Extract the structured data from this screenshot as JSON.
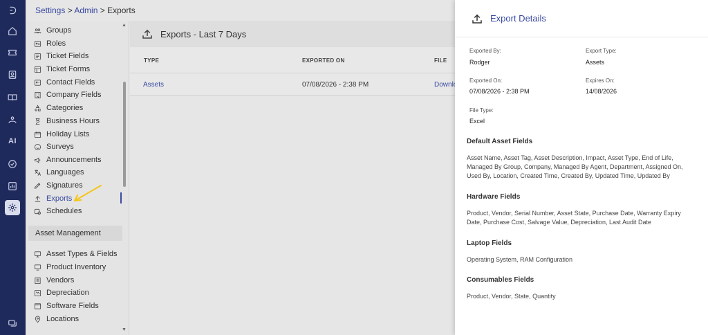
{
  "breadcrumb": {
    "settings": "Settings",
    "sep1": " > ",
    "admin": "Admin",
    "sep2": " > ",
    "current": "Exports"
  },
  "rail": {
    "ai_label": "AI"
  },
  "sidebar": {
    "items": [
      {
        "label": "Groups",
        "icon": "groups-icon"
      },
      {
        "label": "Roles",
        "icon": "roles-icon"
      },
      {
        "label": "Ticket Fields",
        "icon": "ticket-fields-icon"
      },
      {
        "label": "Ticket Forms",
        "icon": "ticket-forms-icon"
      },
      {
        "label": "Contact Fields",
        "icon": "contact-fields-icon"
      },
      {
        "label": "Company Fields",
        "icon": "company-fields-icon"
      },
      {
        "label": "Categories",
        "icon": "categories-icon"
      },
      {
        "label": "Business Hours",
        "icon": "hourglass-icon"
      },
      {
        "label": "Holiday Lists",
        "icon": "calendar-icon"
      },
      {
        "label": "Surveys",
        "icon": "smiley-icon"
      },
      {
        "label": "Announcements",
        "icon": "megaphone-icon"
      },
      {
        "label": "Languages",
        "icon": "translate-icon"
      },
      {
        "label": "Signatures",
        "icon": "signature-icon"
      },
      {
        "label": "Exports",
        "icon": "upload-icon"
      },
      {
        "label": "Schedules",
        "icon": "schedule-icon"
      }
    ],
    "section_header": "Asset Management",
    "asset_items": [
      {
        "label": "Asset Types & Fields",
        "icon": "asset-types-icon"
      },
      {
        "label": "Product Inventory",
        "icon": "inventory-icon"
      },
      {
        "label": "Vendors",
        "icon": "vendors-icon"
      },
      {
        "label": "Depreciation",
        "icon": "depreciation-icon"
      },
      {
        "label": "Software Fields",
        "icon": "software-icon"
      },
      {
        "label": "Locations",
        "icon": "location-icon"
      }
    ]
  },
  "main": {
    "title": "Exports - Last 7 Days",
    "columns": {
      "type": "TYPE",
      "exported_on": "EXPORTED ON",
      "file": "FILE"
    },
    "rows": [
      {
        "type": "Assets",
        "exported_on": "07/08/2026 - 2:38 PM",
        "file": "Downlo"
      }
    ]
  },
  "panel": {
    "title": "Export Details",
    "exported_by_label": "Exported By:",
    "exported_by": "Rodger",
    "export_type_label": "Export Type:",
    "export_type": "Assets",
    "exported_on_label": "Exported On:",
    "exported_on": "07/08/2026 - 2:38 PM",
    "expires_on_label": "Expires On:",
    "expires_on": "14/08/2026",
    "file_type_label": "File Type:",
    "file_type": "Excel",
    "sections": [
      {
        "title": "Default Asset Fields",
        "text": "Asset Name, Asset Tag, Asset Description, Impact, Asset Type, End of Life, Managed By Group, Company, Managed By Agent, Department, Assigned On, Used By, Location, Created Time, Created By, Updated Time, Updated By"
      },
      {
        "title": "Hardware Fields",
        "text": "Product, Vendor, Serial Number, Asset State, Purchase Date, Warranty Expiry Date, Purchase Cost, Salvage Value, Depreciation, Last Audit Date"
      },
      {
        "title": "Laptop Fields",
        "text": "Operating System, RAM Configuration"
      },
      {
        "title": "Consumables Fields",
        "text": "Product, Vendor, State, Quantity"
      }
    ]
  },
  "colors": {
    "rail": "#1f2a5c",
    "accent": "#3a4aa0",
    "arrow": "#f5c518"
  }
}
